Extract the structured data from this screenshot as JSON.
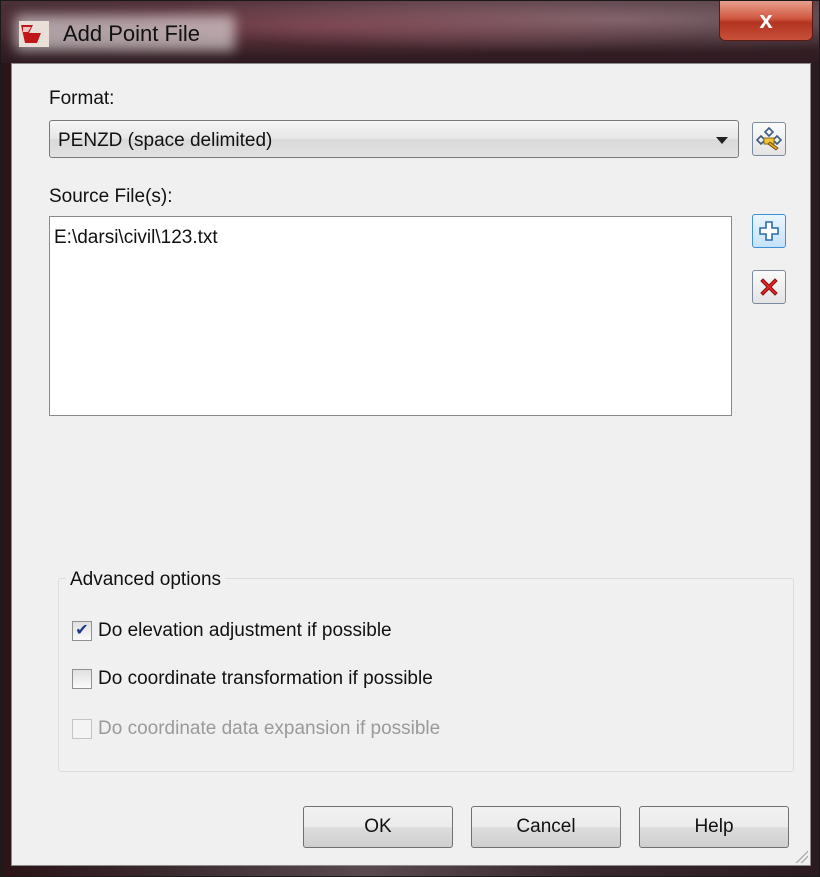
{
  "window": {
    "title": "Add Point File",
    "close_symbol": "x"
  },
  "format": {
    "label": "Format:",
    "selected": "PENZD (space delimited)"
  },
  "source": {
    "label": "Source File(s):",
    "files": [
      "E:\\darsi\\civil\\123.txt"
    ]
  },
  "advanced": {
    "legend": "Advanced options",
    "options": [
      {
        "label": "Do elevation adjustment if possible",
        "checked": true,
        "enabled": true
      },
      {
        "label": "Do coordinate transformation if possible",
        "checked": false,
        "enabled": true
      },
      {
        "label": "Do coordinate data expansion if possible",
        "checked": false,
        "enabled": false
      }
    ]
  },
  "buttons": {
    "ok": "OK",
    "cancel": "Cancel",
    "help": "Help"
  },
  "icons": {
    "app": "autodesk-civil-icon",
    "format_manager": "format-manager-icon",
    "add": "add-plus-icon",
    "remove": "remove-x-icon"
  }
}
